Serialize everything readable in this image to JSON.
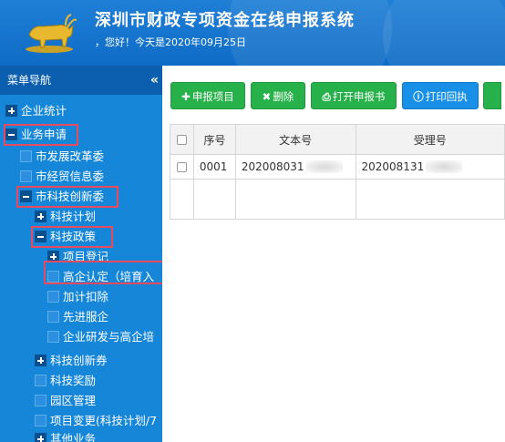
{
  "header": {
    "title": "深圳市财政专项资金在线申报系统",
    "greeting": "，您好！今天是2020年09月25日"
  },
  "sidebar": {
    "title": "菜单导航",
    "collapse_icon": "«",
    "items": [
      {
        "label": "企业统计",
        "icon": "plus"
      },
      {
        "label": "业务申请",
        "icon": "minus"
      },
      {
        "label": "市发展改革委",
        "icon": "leaf"
      },
      {
        "label": "市经贸信息委",
        "icon": "leaf"
      },
      {
        "label": "市科技创新委",
        "icon": "minus"
      },
      {
        "label": "科技计划",
        "icon": "plus"
      },
      {
        "label": "科技政策",
        "icon": "minus"
      },
      {
        "label": "项目登记",
        "icon": "plus"
      },
      {
        "label": "高企认定（培育入",
        "icon": "leaf"
      },
      {
        "label": "加计扣除",
        "icon": "leaf"
      },
      {
        "label": "先进服企",
        "icon": "leaf"
      },
      {
        "label": "企业研发与高企培",
        "icon": "leaf"
      },
      {
        "label": "科技创新券",
        "icon": "plus"
      },
      {
        "label": "科技奖励",
        "icon": "leaf"
      },
      {
        "label": "园区管理",
        "icon": "leaf"
      },
      {
        "label": "项目变更(科技计划/7",
        "icon": "leaf"
      },
      {
        "label": "其他业务",
        "icon": "plus"
      }
    ]
  },
  "toolbar": {
    "add_label": "申报项目",
    "delete_label": "删除",
    "open_label": "打开申报书",
    "print_label": "打印回执"
  },
  "table": {
    "headers": [
      "序号",
      "文本号",
      "受理号"
    ],
    "rows": [
      {
        "index": "0001",
        "text_no": "202008031",
        "accept_no": "202008131"
      }
    ]
  },
  "colors": {
    "header_bg": "#0e6cc6",
    "sidebar_bg": "#1686d9",
    "highlight": "#e84a5f",
    "btn_green": "#27b14a",
    "btn_blue": "#1990e8"
  }
}
